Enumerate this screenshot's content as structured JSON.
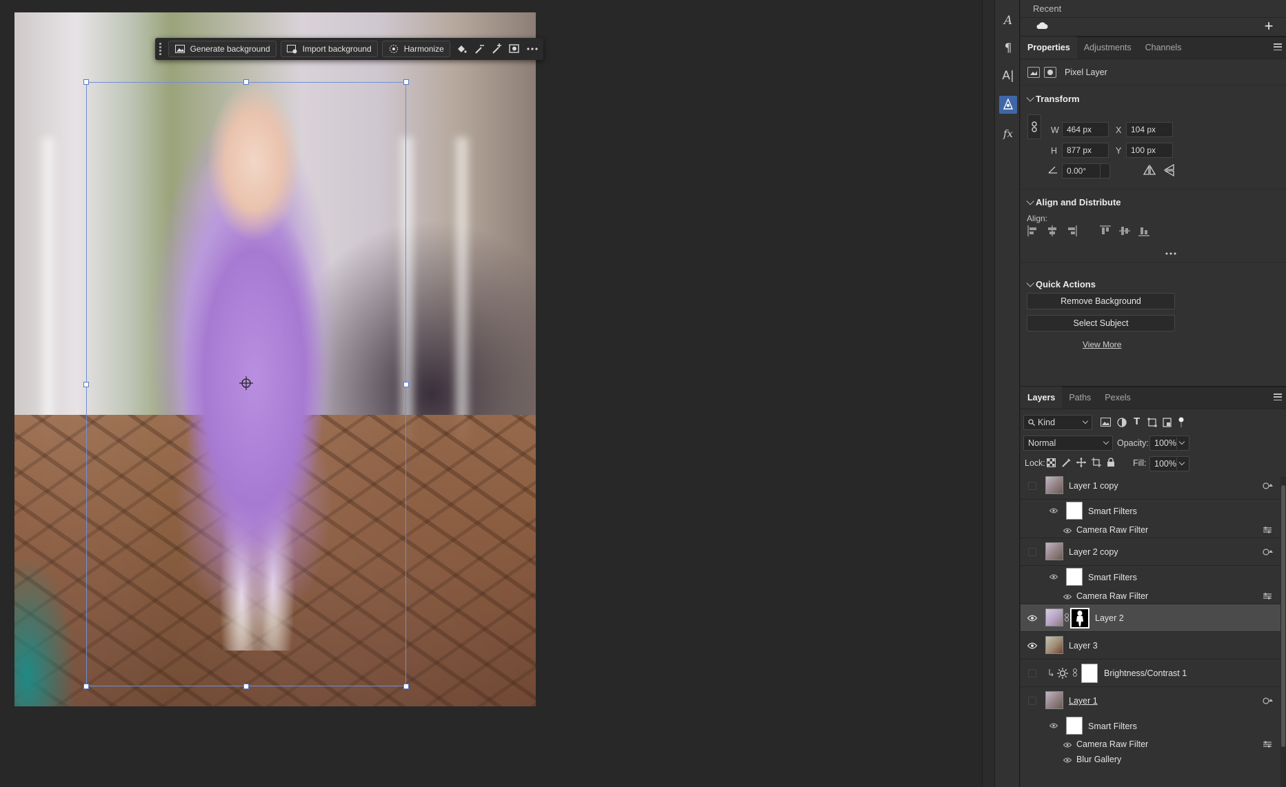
{
  "context_bar": {
    "generate_background": "Generate background",
    "import_background": "Import background",
    "harmonize": "Harmonize"
  },
  "recent": {
    "title": "Recent"
  },
  "properties_tabs": [
    "Properties",
    "Adjustments",
    "Channels"
  ],
  "properties": {
    "layer_type": "Pixel Layer",
    "transform": {
      "title": "Transform",
      "w_label": "W",
      "w_value": "464 px",
      "h_label": "H",
      "h_value": "877 px",
      "x_label": "X",
      "x_value": "104 px",
      "y_label": "Y",
      "y_value": "100 px",
      "angle_value": "0.00°"
    },
    "align": {
      "title": "Align and Distribute",
      "align_label": "Align:"
    },
    "quick_actions": {
      "title": "Quick Actions",
      "remove_background": "Remove Background",
      "select_subject": "Select Subject",
      "view_more": "View More"
    }
  },
  "layers_tabs": [
    "Layers",
    "Paths",
    "Pexels"
  ],
  "layers": {
    "filter_kind": "Kind",
    "blend_mode": "Normal",
    "opacity_label": "Opacity:",
    "opacity_value": "100%",
    "lock_label": "Lock:",
    "fill_label": "Fill:",
    "fill_value": "100%",
    "items": [
      {
        "name": "Layer 1 copy",
        "visible": false,
        "smart_object": true
      },
      {
        "name": "Smart Filters"
      },
      {
        "name": "Camera Raw Filter"
      },
      {
        "name": "Layer 2 copy",
        "visible": false,
        "smart_object": true
      },
      {
        "name": "Smart Filters"
      },
      {
        "name": "Camera Raw Filter"
      },
      {
        "name": "Layer 2",
        "visible": true,
        "selected": true,
        "has_mask": true
      },
      {
        "name": "Layer 3",
        "visible": true
      },
      {
        "name": "Brightness/Contrast 1",
        "visible": false,
        "adjustment": true
      },
      {
        "name": "Layer 1",
        "visible": false,
        "smart_object": true
      },
      {
        "name": "Smart Filters"
      },
      {
        "name": "Camera Raw Filter"
      },
      {
        "name": "Blur Gallery"
      }
    ]
  },
  "colors": {
    "app_bg": "#282828",
    "panel_bg": "#323232",
    "accent": "#3f67a8",
    "selection": "#6f8fd8"
  }
}
